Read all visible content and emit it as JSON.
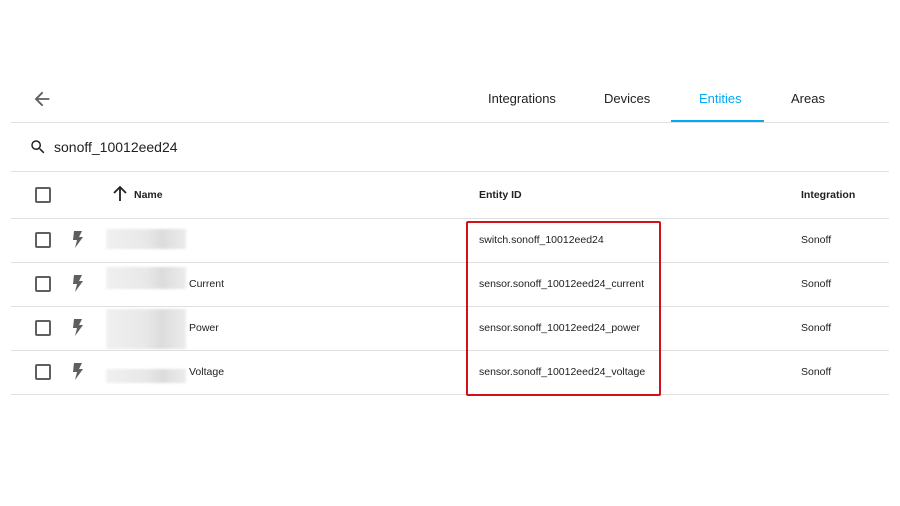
{
  "tabs": [
    {
      "label": "Integrations",
      "active": false
    },
    {
      "label": "Devices",
      "active": false
    },
    {
      "label": "Entities",
      "active": true
    },
    {
      "label": "Areas",
      "active": false
    }
  ],
  "search": {
    "value": "sonoff_10012eed24"
  },
  "table": {
    "columns": {
      "name": "Name",
      "entity_id": "Entity ID",
      "integration": "Integration"
    },
    "rows": [
      {
        "name_suffix": "",
        "entity_id": "switch.sonoff_10012eed24",
        "integration": "Sonoff",
        "icon": "flash-icon"
      },
      {
        "name_suffix": "Current",
        "entity_id": "sensor.sonoff_10012eed24_current",
        "integration": "Sonoff",
        "icon": "flash-icon"
      },
      {
        "name_suffix": "Power",
        "entity_id": "sensor.sonoff_10012eed24_power",
        "integration": "Sonoff",
        "icon": "flash-icon"
      },
      {
        "name_suffix": "Voltage",
        "entity_id": "sensor.sonoff_10012eed24_voltage",
        "integration": "Sonoff",
        "icon": "flash-icon"
      }
    ]
  },
  "colors": {
    "accent": "#03a9f4",
    "highlight_border": "#d0121b",
    "divider": "#e0e0e0"
  }
}
